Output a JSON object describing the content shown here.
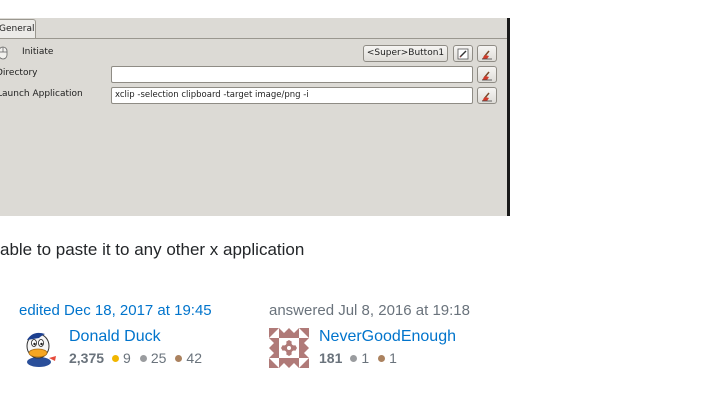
{
  "dialog": {
    "tab_label": "General",
    "rows": [
      {
        "label": "Initiate",
        "shortcut": "<Super>Button1"
      },
      {
        "label": "Directory",
        "value": ""
      },
      {
        "label": "Launch Application",
        "value": "xclip -selection clipboard -target image/png -i"
      }
    ],
    "icons": {
      "row_icon": "mouse-icon",
      "edit": "edit-icon",
      "clear": "clear-icon"
    }
  },
  "body_text": "able to paste it to any other x application",
  "edit_signature": {
    "action": "edited Dec 18, 2017 at 19:45",
    "user": "Donald Duck",
    "reputation": "2,375",
    "badges": [
      {
        "type": "gold",
        "count": "9",
        "color": "#f1b600"
      },
      {
        "type": "silver",
        "count": "25",
        "color": "#9a9c9f"
      },
      {
        "type": "bronze",
        "count": "42",
        "color": "#ab825f"
      }
    ]
  },
  "answer_signature": {
    "action": "answered Jul 8, 2016 at 19:18",
    "user": "NeverGoodEnough",
    "reputation": "181",
    "badges": [
      {
        "type": "silver",
        "count": "1",
        "color": "#9a9c9f"
      },
      {
        "type": "bronze",
        "count": "1",
        "color": "#ab825f"
      }
    ]
  }
}
